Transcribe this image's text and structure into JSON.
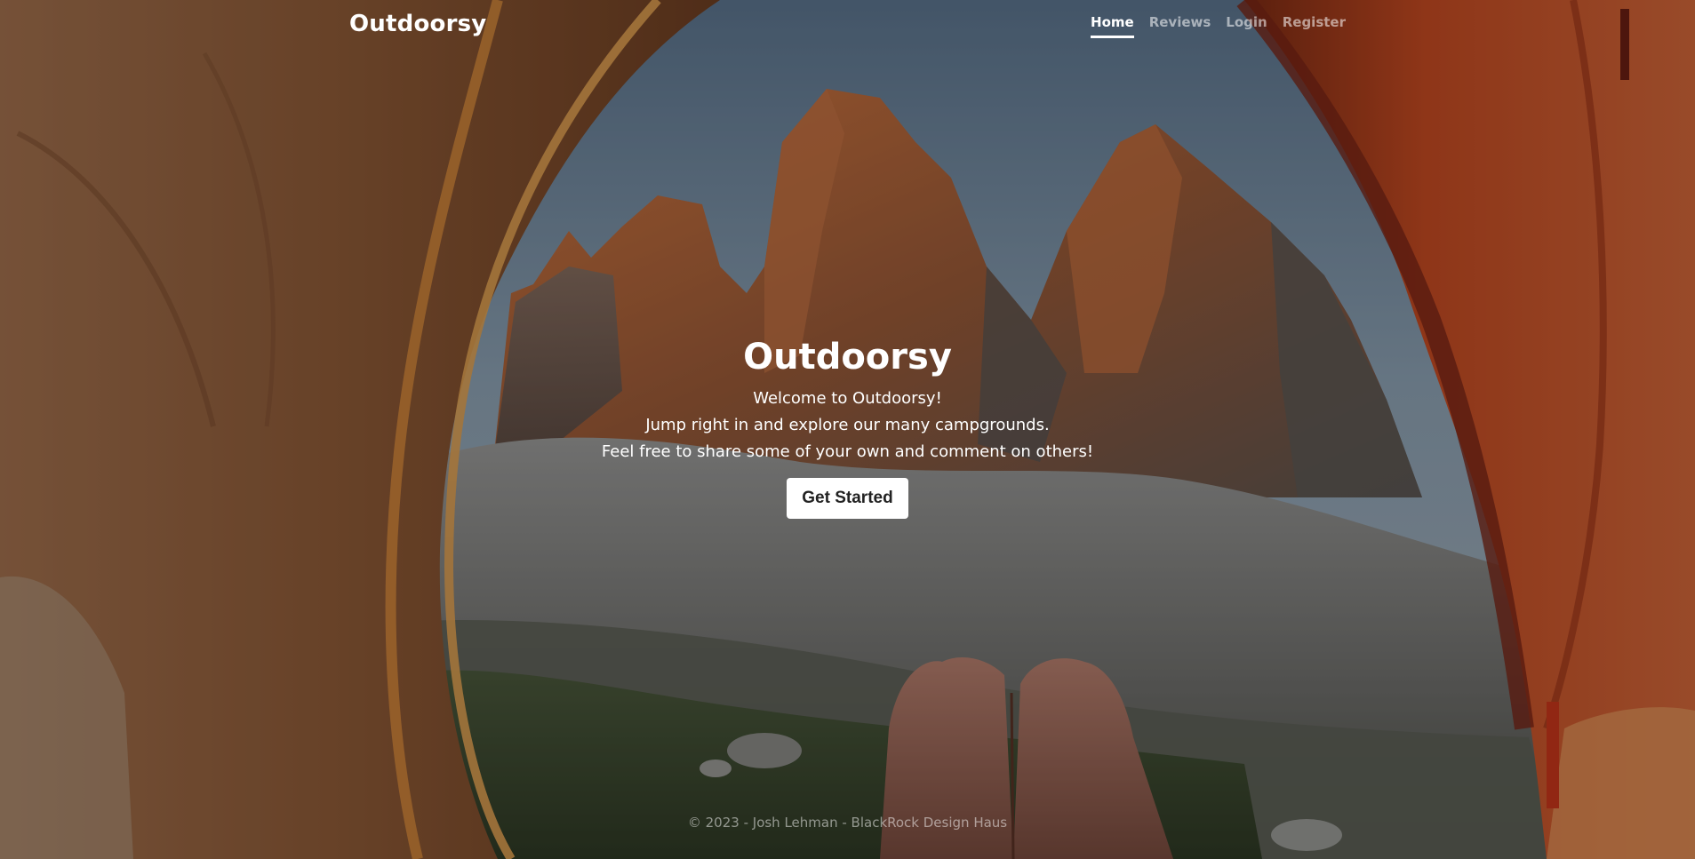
{
  "header": {
    "brand": "Outdoorsy",
    "nav": [
      {
        "label": "Home",
        "active": true
      },
      {
        "label": "Reviews",
        "active": false
      },
      {
        "label": "Login",
        "active": false
      },
      {
        "label": "Register",
        "active": false
      }
    ]
  },
  "hero": {
    "title": "Outdoorsy",
    "lines": [
      "Welcome to Outdoorsy!",
      "Jump right in and explore our many campgrounds.",
      "Feel free to share some of your own and comment on others!"
    ],
    "cta_label": "Get Started"
  },
  "footer": {
    "text": "© 2023 - Josh Lehman - BlackRock Design Haus"
  },
  "colors": {
    "text_primary": "#ffffff",
    "text_muted": "rgba(255,255,255,0.55)",
    "cta_background": "#ffffff",
    "cta_text": "#222222",
    "tent_orange": "#c8662e",
    "sky": "#6f8ba3"
  },
  "icons": {}
}
